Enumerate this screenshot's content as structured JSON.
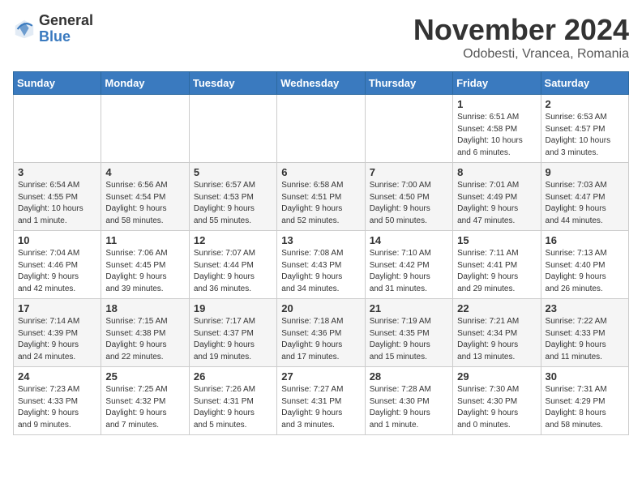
{
  "logo": {
    "general": "General",
    "blue": "Blue"
  },
  "title": "November 2024",
  "location": "Odobesti, Vrancea, Romania",
  "days_header": [
    "Sunday",
    "Monday",
    "Tuesday",
    "Wednesday",
    "Thursday",
    "Friday",
    "Saturday"
  ],
  "weeks": [
    [
      {
        "day": "",
        "info": ""
      },
      {
        "day": "",
        "info": ""
      },
      {
        "day": "",
        "info": ""
      },
      {
        "day": "",
        "info": ""
      },
      {
        "day": "",
        "info": ""
      },
      {
        "day": "1",
        "info": "Sunrise: 6:51 AM\nSunset: 4:58 PM\nDaylight: 10 hours\nand 6 minutes."
      },
      {
        "day": "2",
        "info": "Sunrise: 6:53 AM\nSunset: 4:57 PM\nDaylight: 10 hours\nand 3 minutes."
      }
    ],
    [
      {
        "day": "3",
        "info": "Sunrise: 6:54 AM\nSunset: 4:55 PM\nDaylight: 10 hours\nand 1 minute."
      },
      {
        "day": "4",
        "info": "Sunrise: 6:56 AM\nSunset: 4:54 PM\nDaylight: 9 hours\nand 58 minutes."
      },
      {
        "day": "5",
        "info": "Sunrise: 6:57 AM\nSunset: 4:53 PM\nDaylight: 9 hours\nand 55 minutes."
      },
      {
        "day": "6",
        "info": "Sunrise: 6:58 AM\nSunset: 4:51 PM\nDaylight: 9 hours\nand 52 minutes."
      },
      {
        "day": "7",
        "info": "Sunrise: 7:00 AM\nSunset: 4:50 PM\nDaylight: 9 hours\nand 50 minutes."
      },
      {
        "day": "8",
        "info": "Sunrise: 7:01 AM\nSunset: 4:49 PM\nDaylight: 9 hours\nand 47 minutes."
      },
      {
        "day": "9",
        "info": "Sunrise: 7:03 AM\nSunset: 4:47 PM\nDaylight: 9 hours\nand 44 minutes."
      }
    ],
    [
      {
        "day": "10",
        "info": "Sunrise: 7:04 AM\nSunset: 4:46 PM\nDaylight: 9 hours\nand 42 minutes."
      },
      {
        "day": "11",
        "info": "Sunrise: 7:06 AM\nSunset: 4:45 PM\nDaylight: 9 hours\nand 39 minutes."
      },
      {
        "day": "12",
        "info": "Sunrise: 7:07 AM\nSunset: 4:44 PM\nDaylight: 9 hours\nand 36 minutes."
      },
      {
        "day": "13",
        "info": "Sunrise: 7:08 AM\nSunset: 4:43 PM\nDaylight: 9 hours\nand 34 minutes."
      },
      {
        "day": "14",
        "info": "Sunrise: 7:10 AM\nSunset: 4:42 PM\nDaylight: 9 hours\nand 31 minutes."
      },
      {
        "day": "15",
        "info": "Sunrise: 7:11 AM\nSunset: 4:41 PM\nDaylight: 9 hours\nand 29 minutes."
      },
      {
        "day": "16",
        "info": "Sunrise: 7:13 AM\nSunset: 4:40 PM\nDaylight: 9 hours\nand 26 minutes."
      }
    ],
    [
      {
        "day": "17",
        "info": "Sunrise: 7:14 AM\nSunset: 4:39 PM\nDaylight: 9 hours\nand 24 minutes."
      },
      {
        "day": "18",
        "info": "Sunrise: 7:15 AM\nSunset: 4:38 PM\nDaylight: 9 hours\nand 22 minutes."
      },
      {
        "day": "19",
        "info": "Sunrise: 7:17 AM\nSunset: 4:37 PM\nDaylight: 9 hours\nand 19 minutes."
      },
      {
        "day": "20",
        "info": "Sunrise: 7:18 AM\nSunset: 4:36 PM\nDaylight: 9 hours\nand 17 minutes."
      },
      {
        "day": "21",
        "info": "Sunrise: 7:19 AM\nSunset: 4:35 PM\nDaylight: 9 hours\nand 15 minutes."
      },
      {
        "day": "22",
        "info": "Sunrise: 7:21 AM\nSunset: 4:34 PM\nDaylight: 9 hours\nand 13 minutes."
      },
      {
        "day": "23",
        "info": "Sunrise: 7:22 AM\nSunset: 4:33 PM\nDaylight: 9 hours\nand 11 minutes."
      }
    ],
    [
      {
        "day": "24",
        "info": "Sunrise: 7:23 AM\nSunset: 4:33 PM\nDaylight: 9 hours\nand 9 minutes."
      },
      {
        "day": "25",
        "info": "Sunrise: 7:25 AM\nSunset: 4:32 PM\nDaylight: 9 hours\nand 7 minutes."
      },
      {
        "day": "26",
        "info": "Sunrise: 7:26 AM\nSunset: 4:31 PM\nDaylight: 9 hours\nand 5 minutes."
      },
      {
        "day": "27",
        "info": "Sunrise: 7:27 AM\nSunset: 4:31 PM\nDaylight: 9 hours\nand 3 minutes."
      },
      {
        "day": "28",
        "info": "Sunrise: 7:28 AM\nSunset: 4:30 PM\nDaylight: 9 hours\nand 1 minute."
      },
      {
        "day": "29",
        "info": "Sunrise: 7:30 AM\nSunset: 4:30 PM\nDaylight: 9 hours\nand 0 minutes."
      },
      {
        "day": "30",
        "info": "Sunrise: 7:31 AM\nSunset: 4:29 PM\nDaylight: 8 hours\nand 58 minutes."
      }
    ]
  ]
}
